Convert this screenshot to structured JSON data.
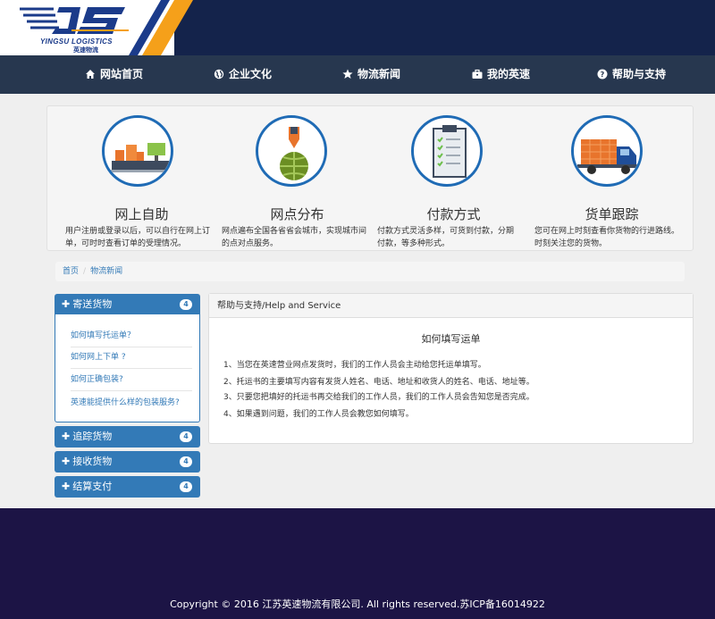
{
  "brand": {
    "logo_letters": "YJS",
    "logo_text": "YINGSU LOGISTICS",
    "logo_cn": "英速物流"
  },
  "nav": [
    {
      "label": "网站首页",
      "icon": "home-icon"
    },
    {
      "label": "企业文化",
      "icon": "globe-icon"
    },
    {
      "label": "物流新闻",
      "icon": "star-icon"
    },
    {
      "label": "我的英速",
      "icon": "briefcase-icon"
    },
    {
      "label": "帮助与支持",
      "icon": "question-circle-icon"
    }
  ],
  "features": [
    {
      "title": "网上自助",
      "desc": "用户注册或登录以后，可以自行在网上订单，可时时查看订单的受理情况。",
      "icon": "self-service-icon"
    },
    {
      "title": "网点分布",
      "desc": "网点遍布全国各省省会城市，实现城市间的点对点服务。",
      "icon": "network-globe-icon"
    },
    {
      "title": "付款方式",
      "desc": "付款方式灵活多样，可货到付款，分期付款，等多种形式。",
      "icon": "clipboard-checklist-icon"
    },
    {
      "title": "货单跟踪",
      "desc": "您可在网上时刻查看你货物的行进路线。时刻关注您的货物。",
      "icon": "delivery-truck-icon"
    }
  ],
  "breadcrumb": {
    "home": "首页",
    "separator": "/",
    "current": "物流新闻"
  },
  "sidebar": {
    "groups": [
      {
        "label": "寄送货物",
        "count": "4",
        "links": [
          "如何填写托运单？",
          "如何网上下单 ?",
          "如何正确包装?",
          "英速能提供什么样的包装服务?"
        ]
      },
      {
        "label": "追踪货物",
        "count": "4"
      },
      {
        "label": "接收货物",
        "count": "4"
      },
      {
        "label": "结算支付",
        "count": "4"
      }
    ]
  },
  "content": {
    "header": "帮助与支持/Help and Service",
    "title": "如何填写运单",
    "lines": [
      "1、当您在英速营业网点发货时，我们的工作人员会主动给您托运单填写。",
      "2、托运书的主要填写内容有发货人姓名、电话、地址和收货人的姓名、电话、地址等。",
      "3、只要您把填好的托运书再交给我们的工作人员，我们的工作人员会告知您是否完成。",
      "4、如果遇到问题，我们的工作人员会教您如何填写。"
    ]
  },
  "footer": {
    "copyright": "Copyright © 2016 江苏英速物流有限公司. All rights reserved.苏ICP备16014922"
  },
  "colors": {
    "header_bg": "#14234b",
    "nav_bg": "#27374f",
    "accent_orange": "#f5a01a",
    "primary_blue": "#337ab7",
    "footer_bg": "#1c1445"
  }
}
